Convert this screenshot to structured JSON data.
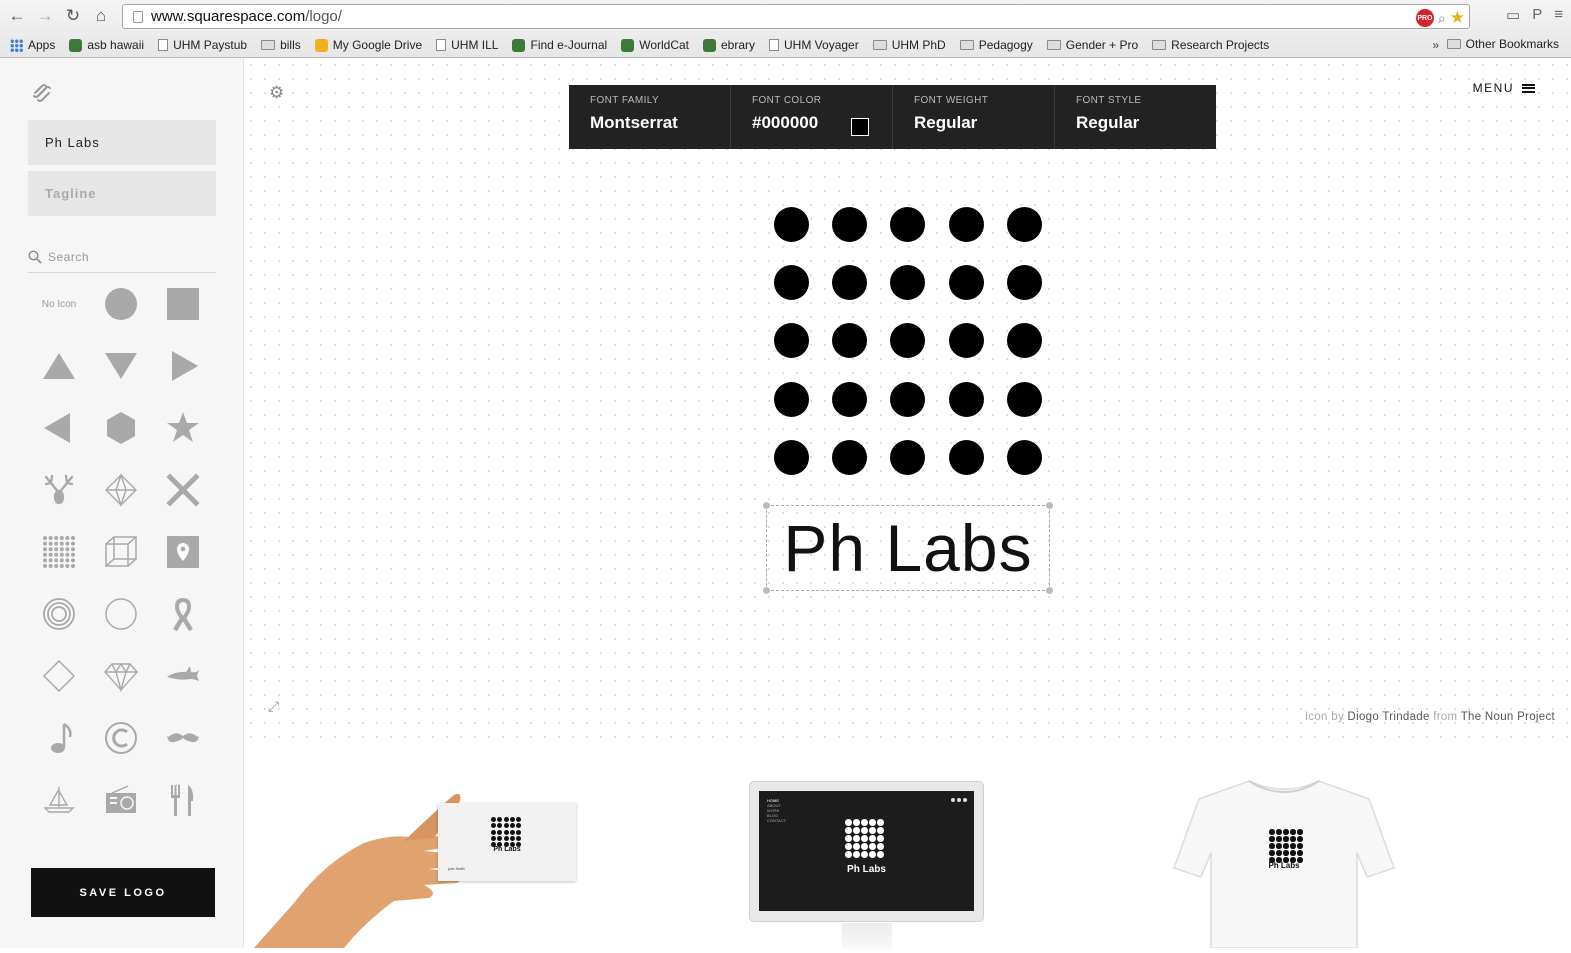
{
  "browser": {
    "url_domain": "www.squarespace.com",
    "url_path": "/logo/",
    "pro_badge": "PRO",
    "bookmarks": [
      {
        "label": "Apps",
        "icon": "apps-grid-icon"
      },
      {
        "label": "asb hawaii",
        "icon": "site-icon"
      },
      {
        "label": "UHM Paystub",
        "icon": "page-icon"
      },
      {
        "label": "bills",
        "icon": "folder-icon"
      },
      {
        "label": "My Google Drive",
        "icon": "drive-icon"
      },
      {
        "label": "UHM ILL",
        "icon": "page-icon"
      },
      {
        "label": "Find e-Journal",
        "icon": "site-icon"
      },
      {
        "label": "WorldCat",
        "icon": "site-icon"
      },
      {
        "label": "ebrary",
        "icon": "site-icon"
      },
      {
        "label": "UHM Voyager",
        "icon": "page-icon"
      },
      {
        "label": "UHM PhD",
        "icon": "folder-icon"
      },
      {
        "label": "Pedagogy",
        "icon": "folder-icon"
      },
      {
        "label": "Gender + Pro",
        "icon": "folder-icon"
      },
      {
        "label": "Research Projects",
        "icon": "folder-icon"
      }
    ],
    "more_chevron": "»",
    "other_bookmarks": "Other Bookmarks"
  },
  "sidebar": {
    "title_value": "Ph Labs",
    "tagline_placeholder": "Tagline",
    "search_placeholder": "Search",
    "no_icon_label": "No Icon",
    "icons": [
      "no-icon",
      "circle-icon",
      "square-icon",
      "triangle-up-icon",
      "triangle-down-icon",
      "triangle-right-icon",
      "triangle-left-icon",
      "hexagon-icon",
      "star-icon",
      "deer-antlers-icon",
      "diamond-gem-outline-icon",
      "x-cross-icon",
      "dot-grid-icon",
      "cube-icon",
      "map-pin-icon",
      "concentric-circles-icon",
      "circle-outline-icon",
      "ribbon-icon",
      "diamond-outline-icon",
      "gem-icon",
      "shark-icon",
      "music-note-icon",
      "copyright-icon",
      "mustache-icon",
      "sailboat-icon",
      "radio-icon",
      "fork-knife-icon"
    ],
    "save_label": "SAVE LOGO"
  },
  "canvas": {
    "menu_label": "MENU",
    "font_bar": [
      {
        "label": "FONT FAMILY",
        "value": "Montserrat"
      },
      {
        "label": "FONT COLOR",
        "value": "#000000"
      },
      {
        "label": "FONT WEIGHT",
        "value": "Regular"
      },
      {
        "label": "FONT STYLE",
        "value": "Regular"
      }
    ],
    "font_color_swatch": "#000000",
    "logo_text": "Ph Labs",
    "credit": {
      "prefix": "Icon by",
      "author": "Diogo Trindade",
      "middle": "from",
      "source": "The Noun Project"
    }
  },
  "mockups": {
    "card_title": "Ph Labs",
    "card_name": "john Smith",
    "monitor_title": "Ph Labs",
    "monitor_nav": [
      "HOME",
      "ABOUT",
      "WORK",
      "BLOG",
      "CONTACT"
    ],
    "tshirt_title": "Ph Labs"
  },
  "colors": {
    "accent": "#222222",
    "save_button": "#111111",
    "sidebar_bg": "#f6f6f6"
  }
}
